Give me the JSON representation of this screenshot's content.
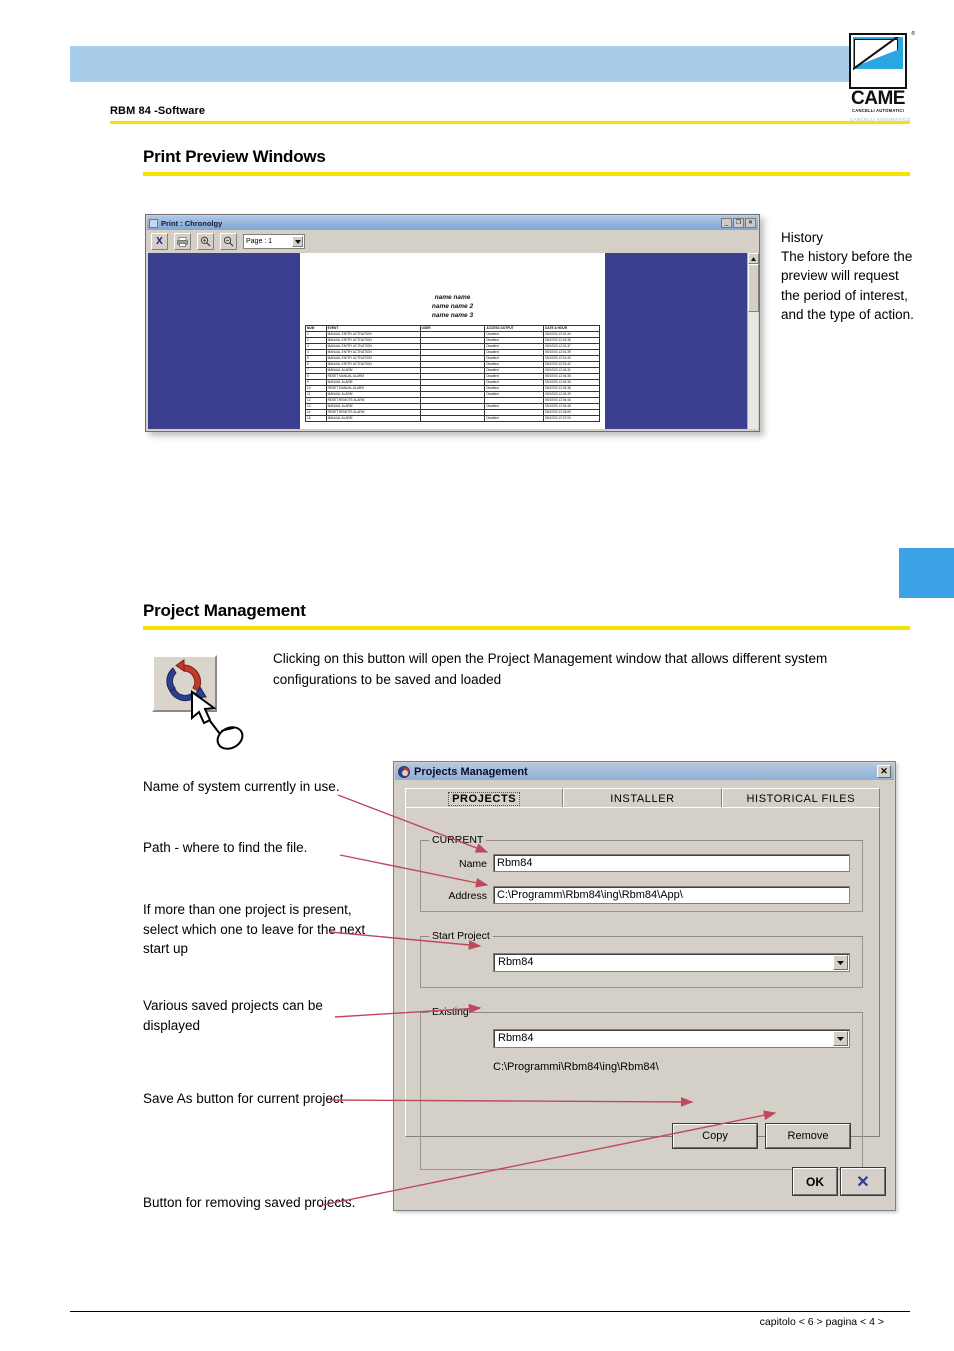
{
  "header": {
    "doc_label": "RBM 84 -Software",
    "logo": {
      "word": "CAME",
      "sub": "CANCELLI AUTOMATICI",
      "sub2": "CANCELLI AUTOMATICO",
      "tm": "®"
    },
    "band_color": "#a8cdea",
    "rule_color": "#f5e400"
  },
  "sections": {
    "print_preview": {
      "title": "Print Preview Windows"
    },
    "project_management": {
      "title": "Project Management"
    }
  },
  "print_preview_window": {
    "title": "Print : Chronolgy",
    "window_buttons": {
      "minimize": "_",
      "restore": "❐",
      "close": "✕"
    },
    "toolbar": {
      "close_label": "X",
      "print_label": "print-icon",
      "zoom_in_label": "zoom-in-icon",
      "zoom_out_label": "zoom-out-icon",
      "page_select_value": "Page : 1",
      "page_select_arrow": "▼"
    },
    "document": {
      "titles": [
        "name name",
        "name name 2",
        "name name 3"
      ],
      "columns": [
        "NUM",
        "EVENT",
        "USER",
        "ACCESS OUTPUT",
        "DATE & HOUR"
      ],
      "rows": [
        [
          "1",
          "MANUAL ENTRY ACTIVATION",
          "",
          "Disabled",
          "05/10/03 12:01:34"
        ],
        [
          "2",
          "MANUAL ENTRY ACTIVATION",
          "",
          "Disabled",
          "05/10/03 12:01:36"
        ],
        [
          "3",
          "MANUAL ENTRY ACTIVATION",
          "",
          "Disabled",
          "05/10/03 12:01:37"
        ],
        [
          "4",
          "MANUAL ENTRY ACTIVATION",
          "",
          "Disabled",
          "05/10/03 12:01:39"
        ],
        [
          "5",
          "MANUAL ENTRY ACTIVATION",
          "",
          "Disabled",
          "05/10/03 12:01:40"
        ],
        [
          "6",
          "MANUAL ENTRY ACTIVATION",
          "",
          "Disabled",
          "05/10/03 12:01:42"
        ],
        [
          "7",
          "MANUAL ALARM",
          "",
          "Disabled",
          "05/10/03 12:04:31"
        ],
        [
          "8",
          "RESET MANUAL ALARM",
          "",
          "Disabled",
          "05/10/03 12:04:35"
        ],
        [
          "9",
          "MANUAL ALARM",
          "",
          "Disabled",
          "05/10/03 12:04:36"
        ],
        [
          "10",
          "RESET MANUAL ALARM",
          "",
          "Disabled",
          "05/10/03 12:04:38"
        ],
        [
          "11",
          "MANUAL ALARM",
          "",
          "Disabled",
          "05/10/03 12:04:39"
        ],
        [
          "12",
          "RESET REMOTE ALARM",
          "",
          "",
          "05/10/03 12:04:46"
        ],
        [
          "13",
          "MANUAL ALARM",
          "",
          "Disabled",
          "05/10/03 12:04:48"
        ],
        [
          "14",
          "RESET REMOTE ALARM",
          "",
          "",
          "05/10/03 12:06:59"
        ],
        [
          "15",
          "MANUAL ALARM",
          "",
          "Disabled",
          "05/10/03 12:07:00"
        ]
      ]
    },
    "side_note": "History\nThe history before the preview will request the period of interest, and the type of action."
  },
  "project_intro": {
    "text": "Clicking on this button will open the Project Management window that allows different system configurations to be saved and loaded"
  },
  "dialog": {
    "title": "Projects Management",
    "close_label": "✕",
    "tabs": [
      {
        "label": "PROJECTS",
        "selected": true
      },
      {
        "label": "INSTALLER",
        "selected": false
      },
      {
        "label": "HISTORICAL FILES",
        "selected": false
      }
    ],
    "current_group": {
      "legend": "CURRENT",
      "name_label": "Name",
      "name_value": "Rbm84",
      "address_label": "Address",
      "address_value": "C:\\Programm\\Rbm84\\ing\\Rbm84\\App\\"
    },
    "start_project_group": {
      "legend": "Start Project",
      "value": "Rbm84",
      "arrow": "▼"
    },
    "existing_group": {
      "legend": "Existing",
      "value": "Rbm84",
      "arrow": "▼",
      "path": "C:\\Programmi\\Rbm84\\ing\\Rbm84\\"
    },
    "buttons": {
      "copy": "Copy",
      "remove": "Remove",
      "ok": "OK",
      "cancel": "✕"
    }
  },
  "annotations": [
    {
      "id": "a1",
      "text": "Name of system currently in use."
    },
    {
      "id": "a2",
      "text": "Path - where to find the file."
    },
    {
      "id": "a3",
      "text": "If more than one project is present, select which one to leave for the next start up"
    },
    {
      "id": "a4",
      "text": "Various saved projects can be displayed"
    },
    {
      "id": "a5",
      "text": "Save As button for current project"
    },
    {
      "id": "a6",
      "text": "Button for removing saved projects."
    }
  ],
  "footer": {
    "text": "capitolo < 6 > pagina < 4 >"
  },
  "colors": {
    "accent_yellow": "#f5e400",
    "header_blue": "#a8cdea",
    "tab_blue": "#3da2e5",
    "preview_bg": "#3b3f8f",
    "arrow_red": "#c0485c"
  }
}
